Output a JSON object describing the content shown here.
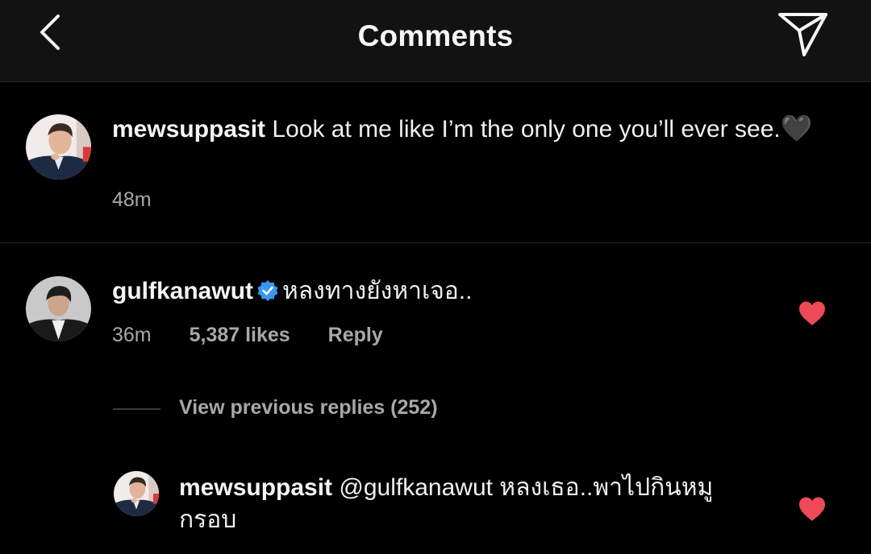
{
  "header": {
    "title": "Comments"
  },
  "caption": {
    "username": "mewsuppasit",
    "text": "Look at me like I’m the only one you’ll ever see.",
    "emoji": "🖤",
    "time": "48m"
  },
  "comment": {
    "username": "gulfkanawut",
    "text": "หลงทางยังหาเจอ..",
    "time": "36m",
    "likes": "5,387 likes",
    "reply_label": "Reply",
    "liked": true
  },
  "view_replies": {
    "label": "View previous replies (252)"
  },
  "reply": {
    "username": "mewsuppasit",
    "text_line1": "@gulfkanawut หลงเธอ..พาไปกินหมู",
    "text_line2": "กรอบ",
    "liked": true
  },
  "colors": {
    "background": "#000000",
    "header_bg": "#121212",
    "text_secondary": "#a8a8a8",
    "heart": "#ed4956",
    "verified": "#3897f0"
  }
}
